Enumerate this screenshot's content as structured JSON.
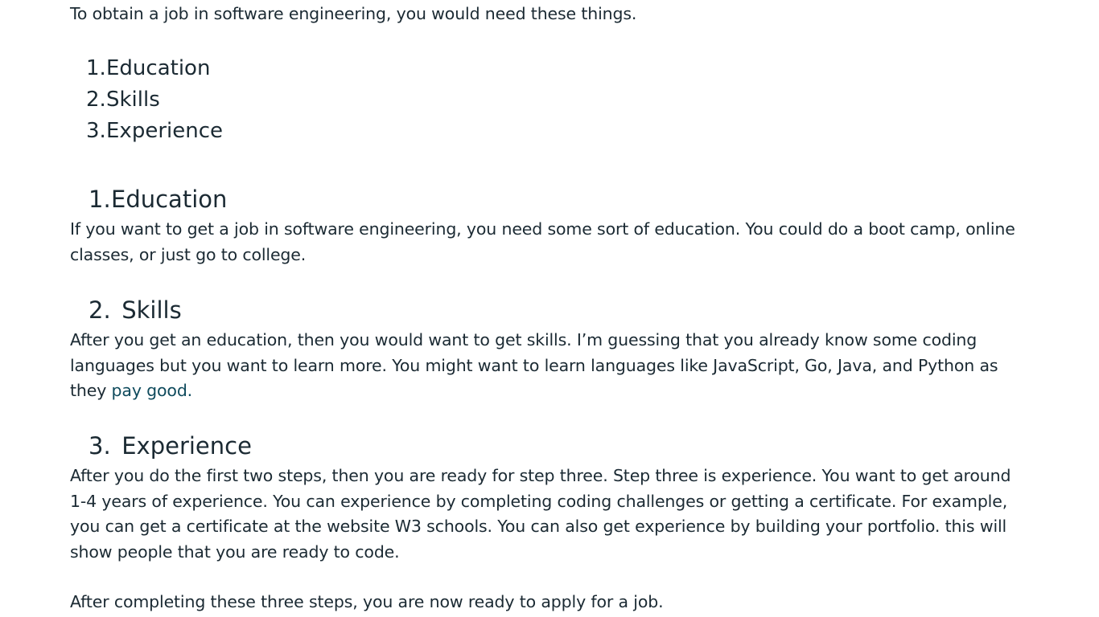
{
  "intro": "To obtain a job in software engineering, you would need these things.",
  "toc": [
    {
      "num": "1.",
      "label": "Education"
    },
    {
      "num": "2.",
      "label": "Skills"
    },
    {
      "num": "3.",
      "label": "Experience"
    }
  ],
  "sections": {
    "education": {
      "num": "1.",
      "title": "Education",
      "body": "If you want to get a job in software engineering, you need some sort of education. You could do a boot camp, online classes, or just go to college."
    },
    "skills": {
      "num": "2.",
      "title": " Skills",
      "body_main": "After you get an education, then you would want to get skills. I’m guessing that you already know some coding languages but you want to learn more. You might want to learn languages like JavaScript, Go, Java, and Python as they ",
      "body_tail": "pay good."
    },
    "experience": {
      "num": "3.",
      "title": " Experience",
      "body": "After you do the first two steps, then you are ready for step three. Step three is experience. You want to get around  1-4 years of experience. You can experience by completing coding challenges or getting a certificate. For example, you can get a certificate at the website W3 schools. You can also get experience by building your portfolio. this will show people that you are ready to code."
    }
  },
  "closing": "After completing these three steps, you are now ready to apply for a job.",
  "colors": {
    "text": "#1b2a33",
    "accent_text": "#0e4a5c",
    "background": "#ffffff"
  }
}
